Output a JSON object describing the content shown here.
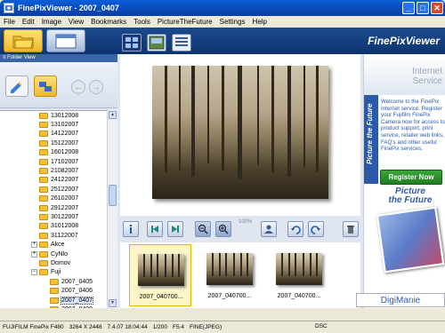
{
  "window": {
    "title": "FinePixViewer  - 2007_0407",
    "buttons": [
      "_",
      "□",
      "✕"
    ]
  },
  "menu": [
    "File",
    "Edit",
    "Image",
    "View",
    "Bookmarks",
    "Tools",
    "PictureTheFuture",
    "Settings",
    "Help"
  ],
  "brand": "FinePixViewer",
  "subbar_label": "≡ Folder View",
  "tree": [
    {
      "label": "13012008",
      "type": "folder"
    },
    {
      "label": "13102007",
      "type": "folder"
    },
    {
      "label": "14122007",
      "type": "folder"
    },
    {
      "label": "15122007",
      "type": "folder"
    },
    {
      "label": "16012008",
      "type": "folder"
    },
    {
      "label": "17102007",
      "type": "folder"
    },
    {
      "label": "21082007",
      "type": "folder"
    },
    {
      "label": "24122007",
      "type": "folder"
    },
    {
      "label": "25122007",
      "type": "folder"
    },
    {
      "label": "26102007",
      "type": "folder"
    },
    {
      "label": "29122007",
      "type": "folder"
    },
    {
      "label": "30122007",
      "type": "folder"
    },
    {
      "label": "31012008",
      "type": "folder"
    },
    {
      "label": "31122007",
      "type": "folder"
    },
    {
      "label": "Akce",
      "type": "expandable"
    },
    {
      "label": "CyNlo",
      "type": "expandable"
    },
    {
      "label": "Domov",
      "type": "folder"
    },
    {
      "label": "Fuji",
      "type": "expanded"
    },
    {
      "label": "2007_0405",
      "type": "child"
    },
    {
      "label": "2007_0406",
      "type": "child"
    },
    {
      "label": "2007_0407",
      "type": "child",
      "selected": true
    },
    {
      "label": "2007_0408",
      "type": "child"
    }
  ],
  "zoom_label": "100%",
  "thumbnails": [
    {
      "caption": "2007_040700...",
      "selected": true
    },
    {
      "caption": "2007_040700...",
      "selected": false
    },
    {
      "caption": "2007_040700...",
      "selected": false
    }
  ],
  "service": {
    "title_line1": "Internet",
    "title_line2": "Service",
    "tab_label": "Picture the Future",
    "text": "Welcome to the FinePix Internet service. Register your Fujifilm FinePix Camera now for access to product support, print service, retailer web links, FAQ's and other useful FinePix services.",
    "register_label": "Register Now",
    "ptf_line1": "Picture",
    "ptf_line2": "the Future"
  },
  "watermark": "DigiManie",
  "status": {
    "camera": "FUJIFILM FinePix F480",
    "resolution": "3264 X 2448",
    "datetime": "7.4.07 18:04:44",
    "shutter": "1/200",
    "aperture": "F5.4",
    "quality": "FINE(JPEG)",
    "dsc": "DSC"
  },
  "colors": {
    "accent": "#f0b828",
    "titlebar": "#0a5fd8",
    "toolbar": "#1a4a8e",
    "register": "#2a8f2a"
  }
}
